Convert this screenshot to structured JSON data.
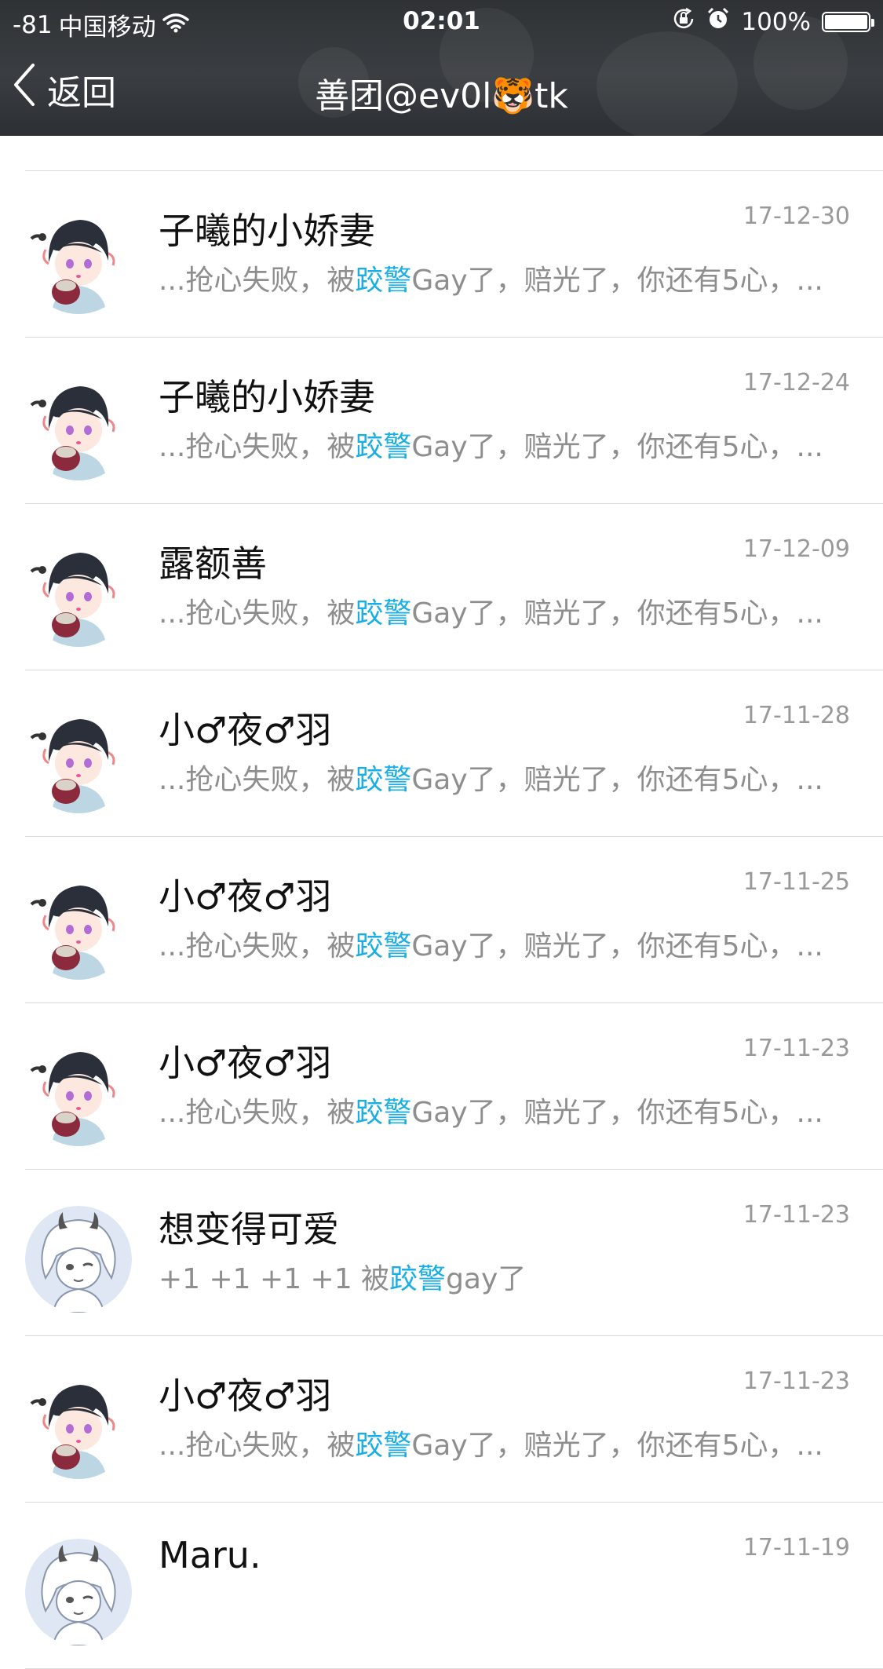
{
  "status_bar": {
    "signal": "-81",
    "carrier": "中国移动",
    "time": "02:01",
    "battery": "100%",
    "battery_level": 1.0
  },
  "nav": {
    "back_label": "返回",
    "title": "善团@ev0l🐯tk"
  },
  "colors": {
    "keyword": "#1aaee6",
    "header_bg": "#33373a",
    "date": "#999999",
    "snippet": "#8e8e8e"
  },
  "messages": [
    {
      "name": "子曦的小娇妻",
      "date": "17-12-30",
      "pre": "...抢心失败，被",
      "keyword": "跤警",
      "post": "Gay了，赔光了，你还有5心，...",
      "avatar": "anime-girl-avatar"
    },
    {
      "name": "子曦的小娇妻",
      "date": "17-12-24",
      "pre": "...抢心失败，被",
      "keyword": "跤警",
      "post": "Gay了，赔光了，你还有5心，...",
      "avatar": "anime-girl-avatar"
    },
    {
      "name": "露额善",
      "date": "17-12-09",
      "pre": "...抢心失败，被",
      "keyword": "跤警",
      "post": "Gay了，赔光了，你还有5心，...",
      "avatar": "anime-girl-avatar"
    },
    {
      "name": "小♂夜♂羽",
      "date": "17-11-28",
      "pre": "...抢心失败，被",
      "keyword": "跤警",
      "post": "Gay了，赔光了，你还有5心，...",
      "avatar": "anime-girl-avatar"
    },
    {
      "name": "小♂夜♂羽",
      "date": "17-11-25",
      "pre": "...抢心失败，被",
      "keyword": "跤警",
      "post": "Gay了，赔光了，你还有5心，...",
      "avatar": "anime-girl-avatar"
    },
    {
      "name": "小♂夜♂羽",
      "date": "17-11-23",
      "pre": "...抢心失败，被",
      "keyword": "跤警",
      "post": "Gay了，赔光了，你还有5心，...",
      "avatar": "anime-girl-avatar"
    },
    {
      "name": "想变得可爱",
      "date": "17-11-23",
      "pre": "+1 +1 +1 +1 被",
      "keyword": "跤警",
      "post": "gay了",
      "avatar": "horned-sketch-avatar"
    },
    {
      "name": "小♂夜♂羽",
      "date": "17-11-23",
      "pre": "...抢心失败，被",
      "keyword": "跤警",
      "post": "Gay了，赔光了，你还有5心，...",
      "avatar": "anime-girl-avatar"
    },
    {
      "name": "Maru.",
      "date": "17-11-19",
      "pre": "",
      "keyword": "",
      "post": "",
      "avatar": "horned-sketch-avatar"
    }
  ]
}
